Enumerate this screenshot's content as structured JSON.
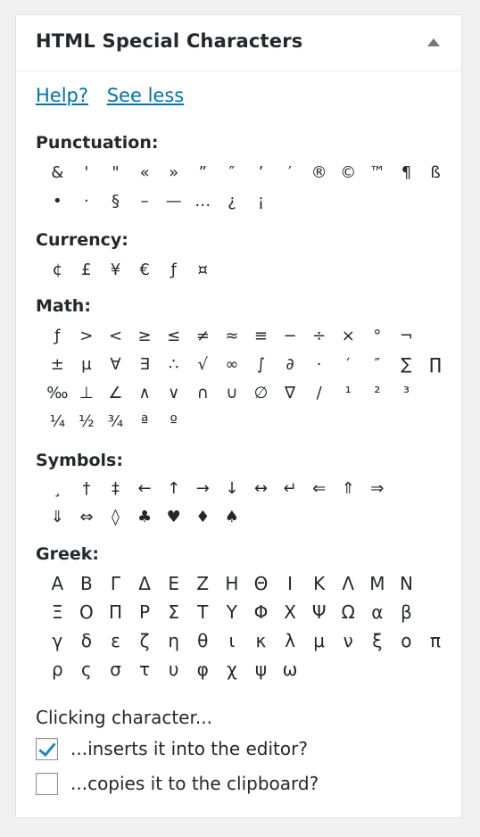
{
  "header": {
    "title": "HTML Special Characters"
  },
  "links": {
    "help": "Help?",
    "see_less": "See less"
  },
  "sections": {
    "punctuation": {
      "title": "Punctuation:",
      "rows": [
        [
          "&",
          "'",
          "\"",
          "«",
          "»",
          "”",
          "″",
          "’",
          "′",
          "®",
          "©",
          "™",
          "¶",
          "ß"
        ],
        [
          "•",
          "·",
          "§",
          "–",
          "—",
          "…",
          "¿",
          "¡"
        ]
      ]
    },
    "currency": {
      "title": "Currency:",
      "rows": [
        [
          "¢",
          "£",
          "¥",
          "€",
          "ƒ",
          "¤"
        ]
      ]
    },
    "math": {
      "title": "Math:",
      "rows": [
        [
          "ƒ",
          ">",
          "<",
          "≥",
          "≤",
          "≠",
          "≈",
          "≡",
          "−",
          "÷",
          "×",
          "°",
          "¬"
        ],
        [
          "±",
          "µ",
          "∀",
          "∃",
          "∴",
          "√",
          "∞",
          "∫",
          "∂",
          "·",
          "′",
          "″",
          "∑",
          "∏"
        ],
        [
          "‰",
          "⊥",
          "∠",
          "∧",
          "∨",
          "∩",
          "∪",
          "∅",
          "∇",
          "/",
          "¹",
          "²",
          "³"
        ],
        [
          "¼",
          "½",
          "¾",
          "ª",
          "º"
        ]
      ]
    },
    "symbols": {
      "title": "Symbols:",
      "rows": [
        [
          "¸",
          "†",
          "‡",
          "←",
          "↑",
          "→",
          "↓",
          "↔",
          "↵",
          "⇐",
          "⇑",
          "⇒"
        ],
        [
          "⇓",
          "⇔",
          "◊",
          "♣",
          "♥",
          "♦",
          "♠"
        ]
      ]
    },
    "greek": {
      "title": "Greek:",
      "rows": [
        [
          "Α",
          "Β",
          "Γ",
          "Δ",
          "Ε",
          "Ζ",
          "Η",
          "Θ",
          "Ι",
          "Κ",
          "Λ",
          "Μ",
          "Ν"
        ],
        [
          "Ξ",
          "Ο",
          "Π",
          "Ρ",
          "Σ",
          "Τ",
          "Υ",
          "Φ",
          "Χ",
          "Ψ",
          "Ω",
          "α",
          "β"
        ],
        [
          "γ",
          "δ",
          "ε",
          "ζ",
          "η",
          "θ",
          "ι",
          "κ",
          "λ",
          "μ",
          "ν",
          "ξ",
          "ο",
          "π"
        ],
        [
          "ρ",
          "ς",
          "σ",
          "τ",
          "υ",
          "φ",
          "χ",
          "ψ",
          "ω"
        ]
      ]
    }
  },
  "options": {
    "title": "Clicking character...",
    "insert_label": "...inserts it into the editor?",
    "insert_checked": true,
    "copy_label": "...copies it to the clipboard?",
    "copy_checked": false
  }
}
